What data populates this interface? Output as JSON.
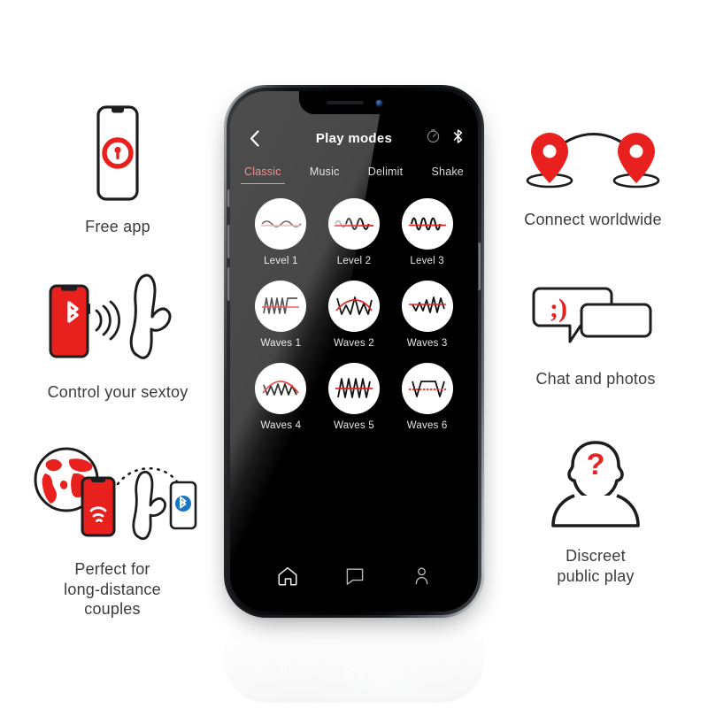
{
  "accent": {
    "red": "#e8201e",
    "soft_red": "#f06360",
    "dark": "#1d1d1f"
  },
  "features_left": [
    {
      "id": "free-app",
      "icon": "phone-lock-icon",
      "caption": "Free app"
    },
    {
      "id": "control",
      "icon": "phone-bluetooth-toy-icon",
      "caption": "Control your sextoy"
    },
    {
      "id": "long-dist",
      "icon": "globe-phones-toy-icon",
      "caption": "Perfect for\nlong-distance\ncouples",
      "caption_lines": [
        "Perfect for",
        "long-distance",
        "couples"
      ]
    }
  ],
  "features_right": [
    {
      "id": "connect",
      "icon": "two-map-pins-arc-icon",
      "caption": "Connect worldwide"
    },
    {
      "id": "chat",
      "icon": "speech-bubbles-icon",
      "caption": "Chat and photos",
      "emoticon": ";)"
    },
    {
      "id": "discreet",
      "icon": "anonymous-person-icon",
      "caption_lines": [
        "Discreet",
        "public play"
      ],
      "caption": "Discreet public play",
      "symbol": "?"
    }
  ],
  "phone": {
    "app": {
      "header": {
        "back_icon": "chevron-left-icon",
        "title": "Play modes",
        "right_icons": [
          {
            "name": "timer-icon",
            "label": "Timer"
          },
          {
            "name": "bluetooth-icon",
            "label": "Bluetooth"
          }
        ]
      },
      "tabs": [
        {
          "label": "Classic",
          "active": true
        },
        {
          "label": "Music",
          "active": false
        },
        {
          "label": "Delimit",
          "active": false
        },
        {
          "label": "Shake",
          "active": false
        }
      ],
      "modes": [
        {
          "label": "Level 1",
          "wave": "sine-low"
        },
        {
          "label": "Level 2",
          "wave": "sine-mid"
        },
        {
          "label": "Level 3",
          "wave": "sine-high"
        },
        {
          "label": "Waves 1",
          "wave": "ramp-step"
        },
        {
          "label": "Waves 2",
          "wave": "zigzag-arc"
        },
        {
          "label": "Waves 3",
          "wave": "zigzag-rising"
        },
        {
          "label": "Waves 4",
          "wave": "zigzag-dome"
        },
        {
          "label": "Waves 5",
          "wave": "sawtooth"
        },
        {
          "label": "Waves 6",
          "wave": "trapezoid"
        }
      ],
      "tabbar": [
        {
          "name": "home-icon",
          "label": "Home",
          "active": true
        },
        {
          "name": "chat-icon",
          "label": "Chat",
          "active": false
        },
        {
          "name": "profile-icon",
          "label": "Profile",
          "active": false
        }
      ]
    }
  }
}
